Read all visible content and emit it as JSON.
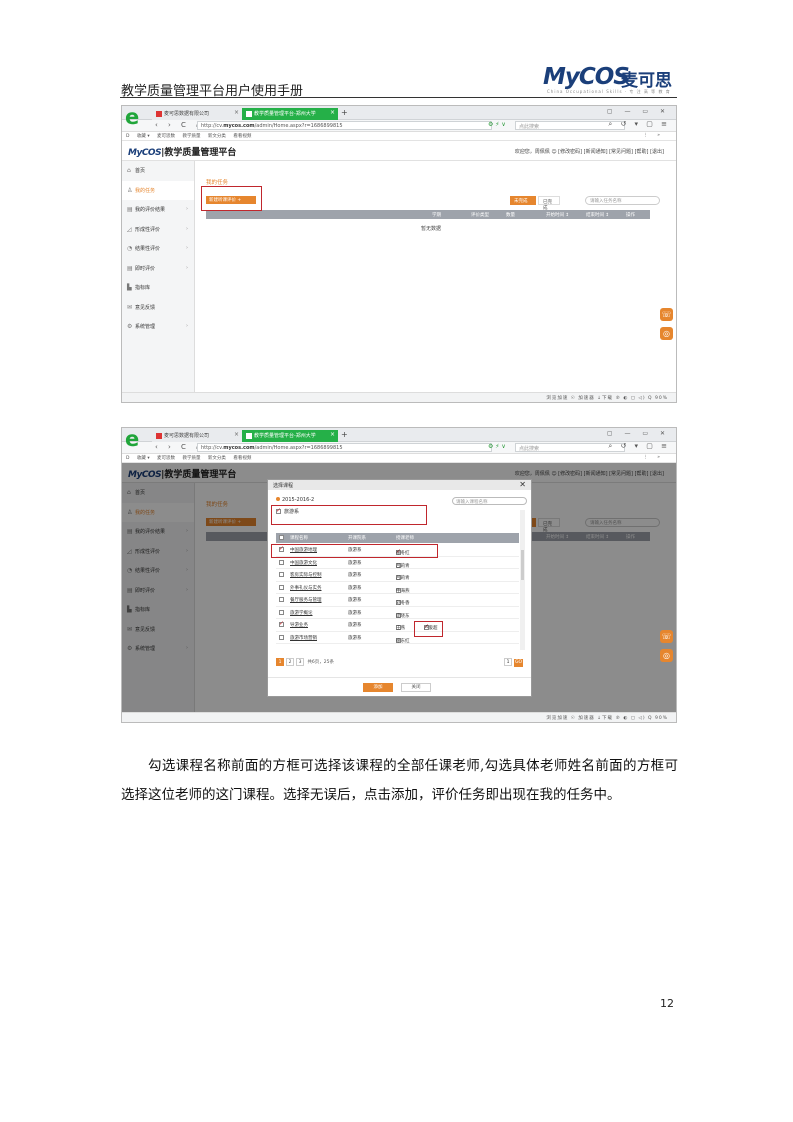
{
  "doc": {
    "header_title": "教学质量管理平台用户使用手册",
    "logo_text": "MyCOS麦可思",
    "logo_sub": "China Occupational Skills · 专 注 高 等 教 育",
    "caption": "勾选课程名称前面的方框可选择该课程的全部任课老师,勾选具体老师姓名前面的方框可选择这位老师的这门课程。选择无误后，点击添加，评价任务即出现在我的任务中。",
    "page_number": "12"
  },
  "browser": {
    "tab1_label": "麦可思数据有限公司",
    "tab2_label": "教学质量管理平台-郑州大学",
    "tab_close": "×",
    "new_tab": "+",
    "window_buttons": "▢ — ▭ ✕",
    "nav_buttons": "‹ › C ⌂",
    "url_prefix": "http://cv.",
    "url_bold": "mycos.com",
    "url_suffix": "/admin/Home.aspx?r=1686899815",
    "search_placeholder": "点此搜索",
    "addr_right": "⌕ ↺ ▾ ▢ ≡",
    "addr_icons": "⚙ ⚡ ∨",
    "bookmarks": [
      "D",
      "收藏 ▾",
      "麦可思数",
      "教学质量",
      "新文分类",
      "看看视频"
    ],
    "bookmarks_right": "⋮ »",
    "statusbar": "浏览加速  ☉  加速器  ↓下载  ℗  ◐  ▢  ◁)  Q 90%",
    "statusbar_green": "▣ 浏览加速"
  },
  "app": {
    "brand": "MyCOS",
    "title": "|教学质量管理平台",
    "user_bar": "欢迎您，周佩佩 ☺   [修改密码]  [新闻通知]  [常见问题]  [帮助]  [退出]",
    "sidebar": [
      {
        "icon": "⌂",
        "label": "首页",
        "chevron": ""
      },
      {
        "icon": "♙",
        "label": "我的任务",
        "chevron": ""
      },
      {
        "icon": "▤",
        "label": "我的评价结果",
        "chevron": "›"
      },
      {
        "icon": "◿",
        "label": "形成性评价",
        "chevron": "›"
      },
      {
        "icon": "◔",
        "label": "结果性评价",
        "chevron": "›"
      },
      {
        "icon": "▤",
        "label": "即时评价",
        "chevron": "›"
      },
      {
        "icon": "▙",
        "label": "指标库",
        "chevron": ""
      },
      {
        "icon": "✉",
        "label": "意见反馈",
        "chevron": ""
      },
      {
        "icon": "⚙",
        "label": "系统管理",
        "chevron": "›"
      }
    ],
    "breadcrumb": "我的任务",
    "new_btn": "新建听课评价  +",
    "toggle_a": "未完成",
    "toggle_b": "已完成",
    "task_search_placeholder": "请输入任务名称",
    "table_headers": [
      "学期",
      "评价类型",
      "数量",
      "开始时间 ↕",
      "结束时间 ↕",
      "操作"
    ],
    "empty_text": "暂无数据",
    "float_phone": "☏",
    "float_qq": "◎"
  },
  "dialog": {
    "title": "选择课程",
    "close": "✕",
    "term": "2015-2016-2",
    "search_placeholder": "请输入课程名称",
    "dept": "旅游系",
    "headers": [
      "课程名称",
      "开课院系",
      "授课老师"
    ],
    "rows": [
      {
        "course": "中国旅游地理",
        "dept": "旅游系",
        "teachers": "徐冬红",
        "checked": true,
        "tchecked": true
      },
      {
        "course": "中国旅游文化",
        "dept": "旅游系",
        "teachers": "吕莉青",
        "checked": false,
        "tchecked": false
      },
      {
        "course": "客房实际与控制",
        "dept": "旅游系",
        "teachers": "吕莉青",
        "checked": false,
        "tchecked": false
      },
      {
        "course": "外事礼仪与实务",
        "dept": "旅游系",
        "teachers": "牛海燕",
        "checked": false,
        "tchecked": false
      },
      {
        "course": "餐厅服务与管理",
        "dept": "旅游系",
        "teachers": "刘冬香",
        "checked": false,
        "tchecked": false
      },
      {
        "course": "旅游学概论",
        "dept": "旅游系",
        "teachers": "庞晓东",
        "checked": false,
        "tchecked": false
      },
      {
        "course": "导游业务",
        "dept": "旅游系",
        "teachers": "王燕",
        "teachers2": "卢俊超",
        "checked": true,
        "tchecked": false,
        "t2checked": true
      },
      {
        "course": "旅游市场营销",
        "dept": "旅游系",
        "teachers": "徐东红",
        "checked": false,
        "tchecked": false
      }
    ],
    "pages": [
      "1",
      "2",
      "3"
    ],
    "page_info": "共6页，25条",
    "page_input": "1",
    "go": "GO",
    "add_btn": "添加",
    "close_btn": "关闭"
  }
}
